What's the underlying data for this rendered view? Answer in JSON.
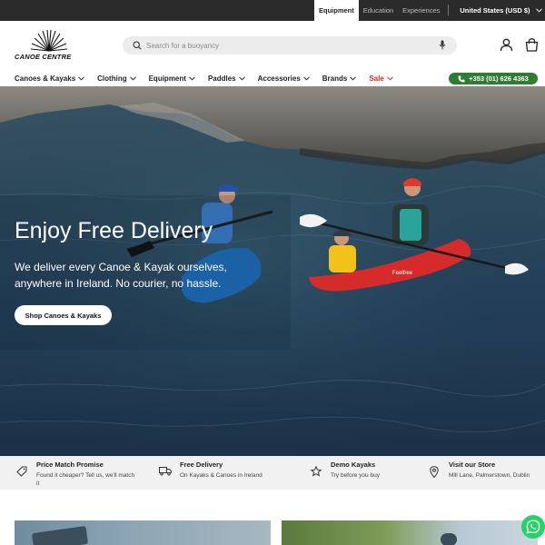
{
  "topbar": {
    "tabs": [
      {
        "label": "Equipment",
        "active": true
      },
      {
        "label": "Education",
        "active": false
      },
      {
        "label": "Experiences",
        "active": false
      }
    ],
    "currency": "United States (USD $)"
  },
  "header": {
    "logo_text": "CANOE CENTRE",
    "search": {
      "placeholder": "Search for a buoyancy",
      "value": ""
    },
    "icons": [
      "search-icon",
      "microphone-icon",
      "account-icon",
      "cart-icon"
    ]
  },
  "nav": {
    "items": [
      {
        "label": "Canoes & Kayaks"
      },
      {
        "label": "Clothing"
      },
      {
        "label": "Equipment"
      },
      {
        "label": "Paddles"
      },
      {
        "label": "Accessories"
      },
      {
        "label": "Brands"
      },
      {
        "label": "Sale"
      }
    ],
    "phone": "+353 (01) 626 4363"
  },
  "hero": {
    "title": "Enjoy Free Delivery",
    "text": "We deliver every Canoe & Kayak ourselves, anywhere in Ireland. No courier, no hassle.",
    "button": "Shop Canoes & Kayaks",
    "kayak_brand": "Feelfree"
  },
  "features": [
    {
      "icon": "tag-icon",
      "title": "Price Match Promise",
      "desc": "Found it cheaper? Tell us, we'll match it"
    },
    {
      "icon": "truck-icon",
      "title": "Free Delivery",
      "desc": "On Kayaks & Canoes in Ireland"
    },
    {
      "icon": "star-icon",
      "title": "Demo Kayaks",
      "desc": "Try before you buy"
    },
    {
      "icon": "location-pin-icon",
      "title": "Visit our Store",
      "desc": "Mill Lane, Palmerstown, Dublin"
    }
  ],
  "colors": {
    "topbar_bg": "#2b2b2b",
    "accent_green": "#2e7d32",
    "sale_red": "#d2262a",
    "whatsapp_green": "#25d366",
    "kayak_blue": "#1e6fc0",
    "kayak_red": "#d62b2b"
  }
}
